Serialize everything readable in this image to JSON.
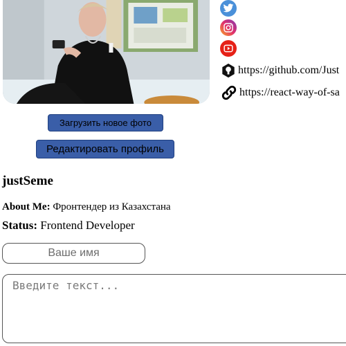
{
  "profile": {
    "username": "justSeme",
    "about_label": "About Me:",
    "about_text": "Фронтендер из Казахстана",
    "status_label": "Status:",
    "status_text": "Frontend Developer"
  },
  "buttons": {
    "upload_photo": "Загрузить новое фото",
    "edit_profile": "Редактировать профиль"
  },
  "social": [
    {
      "icon": "twitter-icon",
      "color": "#4a90d9"
    },
    {
      "icon": "instagram-icon",
      "color": "#c13584"
    },
    {
      "icon": "youtube-icon",
      "color": "#e62117"
    }
  ],
  "links": {
    "github": "https://github.com/Just",
    "website": "https://react-way-of-sa"
  },
  "form": {
    "name_placeholder": "Ваше имя",
    "text_placeholder": "Введите текст..."
  }
}
